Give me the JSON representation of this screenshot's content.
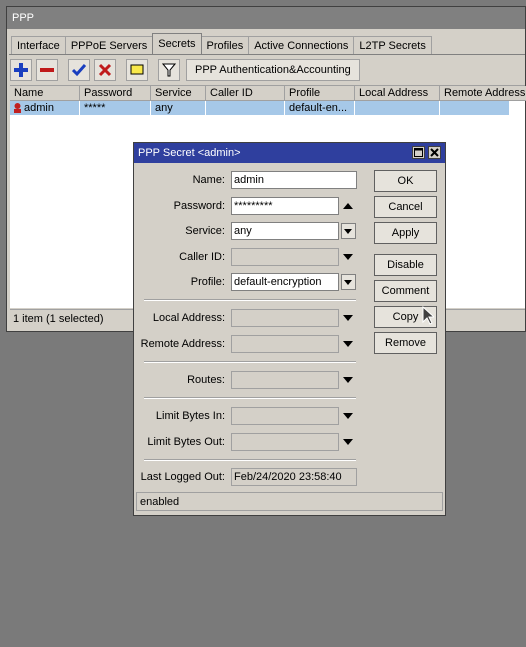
{
  "window": {
    "title": "PPP"
  },
  "tabs": [
    {
      "label": "Interface"
    },
    {
      "label": "PPPoE Servers"
    },
    {
      "label": "Secrets",
      "active": true
    },
    {
      "label": "Profiles"
    },
    {
      "label": "Active Connections"
    },
    {
      "label": "L2TP Secrets"
    }
  ],
  "toolbar": {
    "add_icon": "plus-icon",
    "remove_icon": "minus-icon",
    "enable_icon": "check-icon",
    "disable_icon": "x-icon",
    "comment_icon": "comment-icon",
    "filter_icon": "filter-icon",
    "auth_button": "PPP Authentication&Accounting"
  },
  "table": {
    "columns": [
      "Name",
      "Password",
      "Service",
      "Caller ID",
      "Profile",
      "Local Address",
      "Remote Address"
    ],
    "rows": [
      {
        "name": "admin",
        "password": "*****",
        "service": "any",
        "caller_id": "",
        "profile": "default-en...",
        "local_address": "",
        "remote_address": ""
      }
    ]
  },
  "status": "1 item (1 selected)",
  "dialog": {
    "title": "PPP Secret <admin>",
    "fields": {
      "name": {
        "label": "Name:",
        "value": "admin"
      },
      "password": {
        "label": "Password:",
        "value": "*********"
      },
      "service": {
        "label": "Service:",
        "value": "any"
      },
      "caller_id": {
        "label": "Caller ID:",
        "value": ""
      },
      "profile": {
        "label": "Profile:",
        "value": "default-encryption"
      },
      "local_address": {
        "label": "Local Address:",
        "value": ""
      },
      "remote_address": {
        "label": "Remote Address:",
        "value": ""
      },
      "routes": {
        "label": "Routes:",
        "value": ""
      },
      "limit_in": {
        "label": "Limit Bytes In:",
        "value": ""
      },
      "limit_out": {
        "label": "Limit Bytes Out:",
        "value": ""
      },
      "last_logged_out": {
        "label": "Last Logged Out:",
        "value": "Feb/24/2020 23:58:40"
      }
    },
    "buttons": {
      "ok": "OK",
      "cancel": "Cancel",
      "apply": "Apply",
      "disable": "Disable",
      "comment": "Comment",
      "copy": "Copy",
      "remove": "Remove"
    },
    "status": "enabled"
  },
  "colors": {
    "dialog_title": "#2f3f9e",
    "selected_row": "#a6c8e8",
    "window_bg": "#d4d0c8",
    "desktop": "#7a7a7a"
  }
}
